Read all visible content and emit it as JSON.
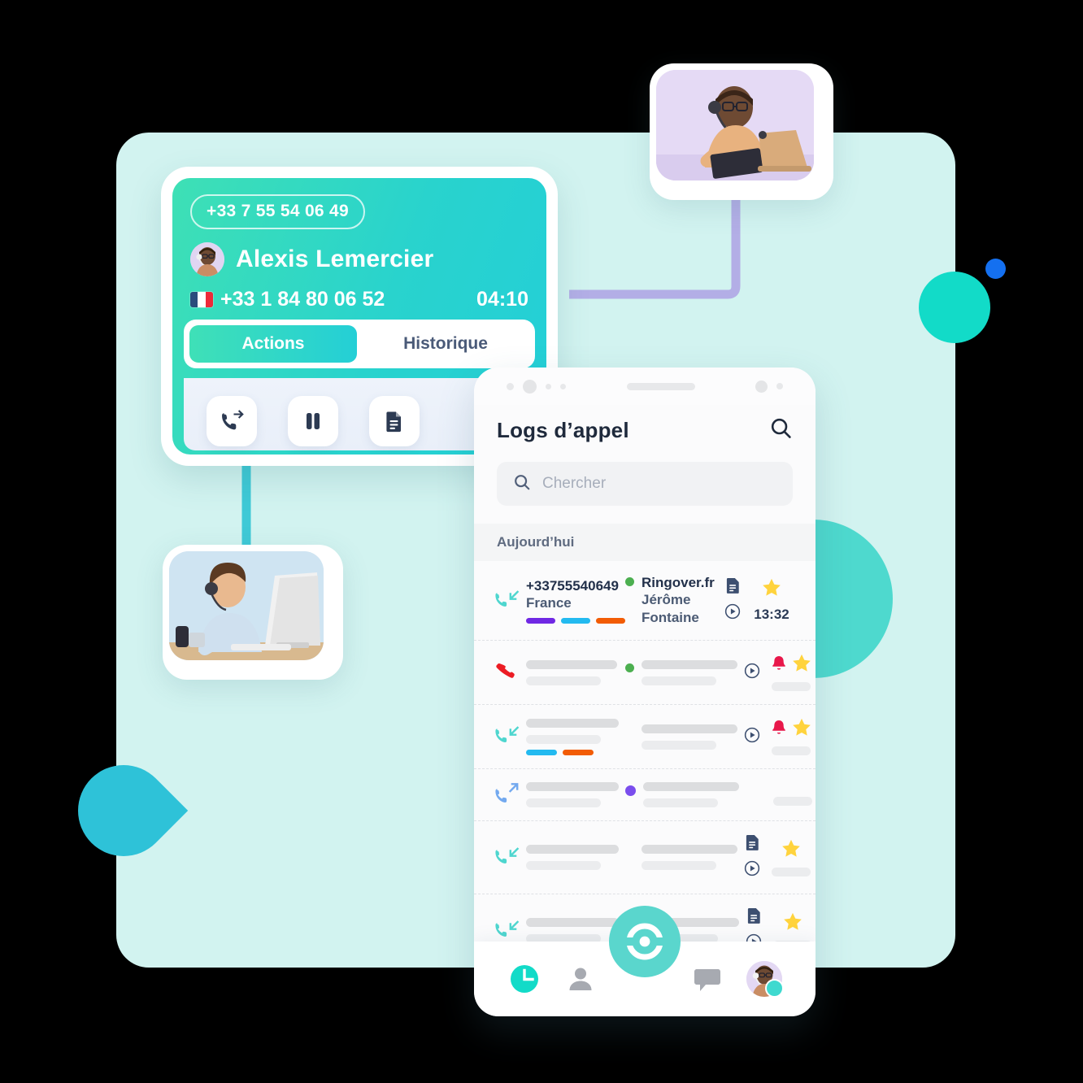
{
  "call_card": {
    "caller_number_pill": "+33 7 55 54 06 49",
    "caller_name": "Alexis Lemercier",
    "line_number": "+33 1 84 80 06 52",
    "timer": "04:10",
    "tabs": [
      {
        "label": "Actions",
        "active": true
      },
      {
        "label": "Historique",
        "active": false
      }
    ],
    "actions": [
      {
        "label": "transfert",
        "icon": "call-transfer-icon"
      },
      {
        "label": "attente",
        "icon": "pause-icon"
      },
      {
        "label": "note",
        "icon": "note-document-icon"
      }
    ]
  },
  "phone": {
    "title": "Logs d’appel",
    "header_search_icon": "search-icon",
    "search": {
      "placeholder": "Chercher",
      "value": "",
      "icon": "search-icon"
    },
    "section_label": "Aujourd’hui",
    "rows": [
      {
        "direction": "incoming",
        "direction_icon": "phone-incoming-icon",
        "number": "+33755540649",
        "country": "France",
        "status_color": "#4caf50",
        "account": "Ringover.fr",
        "agent": "Jérôme Fontaine",
        "tags": [
          "#7028e4",
          "#23baf0",
          "#f25c05"
        ],
        "has_note": true,
        "has_play": true,
        "has_bell": false,
        "starred": true,
        "time": "13:32",
        "placeholder_row": false
      },
      {
        "direction": "missed",
        "direction_icon": "phone-missed-icon",
        "status_color": "#4caf50",
        "tags": [],
        "has_note": false,
        "has_play": true,
        "has_bell": true,
        "starred": true,
        "placeholder_row": true
      },
      {
        "direction": "incoming",
        "direction_icon": "phone-incoming-icon",
        "status_color": null,
        "tags": [
          "#23baf0",
          "#f25c05"
        ],
        "has_note": false,
        "has_play": true,
        "has_bell": true,
        "starred": true,
        "placeholder_row": true
      },
      {
        "direction": "outgoing",
        "direction_icon": "phone-outgoing-icon",
        "status_color": "#7a4ded",
        "tags": [],
        "has_note": false,
        "has_play": false,
        "has_bell": false,
        "starred": false,
        "placeholder_row": true
      },
      {
        "direction": "incoming",
        "direction_icon": "phone-incoming-icon",
        "status_color": null,
        "tags": [],
        "has_note": true,
        "has_play": true,
        "has_bell": false,
        "starred": true,
        "placeholder_row": true
      },
      {
        "direction": "incoming",
        "direction_icon": "phone-incoming-icon",
        "status_color": "#7cc24a",
        "tags": [],
        "has_note": true,
        "has_play": true,
        "has_bell": false,
        "starred": true,
        "placeholder_row": true
      }
    ],
    "nav": [
      {
        "name": "recents",
        "icon": "clock-icon",
        "active": true
      },
      {
        "name": "contacts",
        "icon": "person-icon",
        "active": false
      },
      {
        "name": "dialer",
        "icon": "ringover-logo-icon",
        "active": false
      },
      {
        "name": "messages",
        "icon": "chat-bubble-icon",
        "active": false
      },
      {
        "name": "profile",
        "icon": "avatar-icon",
        "active": false
      }
    ]
  },
  "decorations": {
    "photo_top_alt": "agent-with-headset-laptop-photo",
    "photo_left_alt": "agent-with-headset-desktop-photo",
    "panel_color": "#d2f3f0",
    "accent_teal": "#12dbc8",
    "accent_blue": "#1470f0",
    "accent_cyan": "#2ec2d8",
    "connector_teal": "#3fc9d6",
    "connector_purple": "#b3aee6"
  }
}
